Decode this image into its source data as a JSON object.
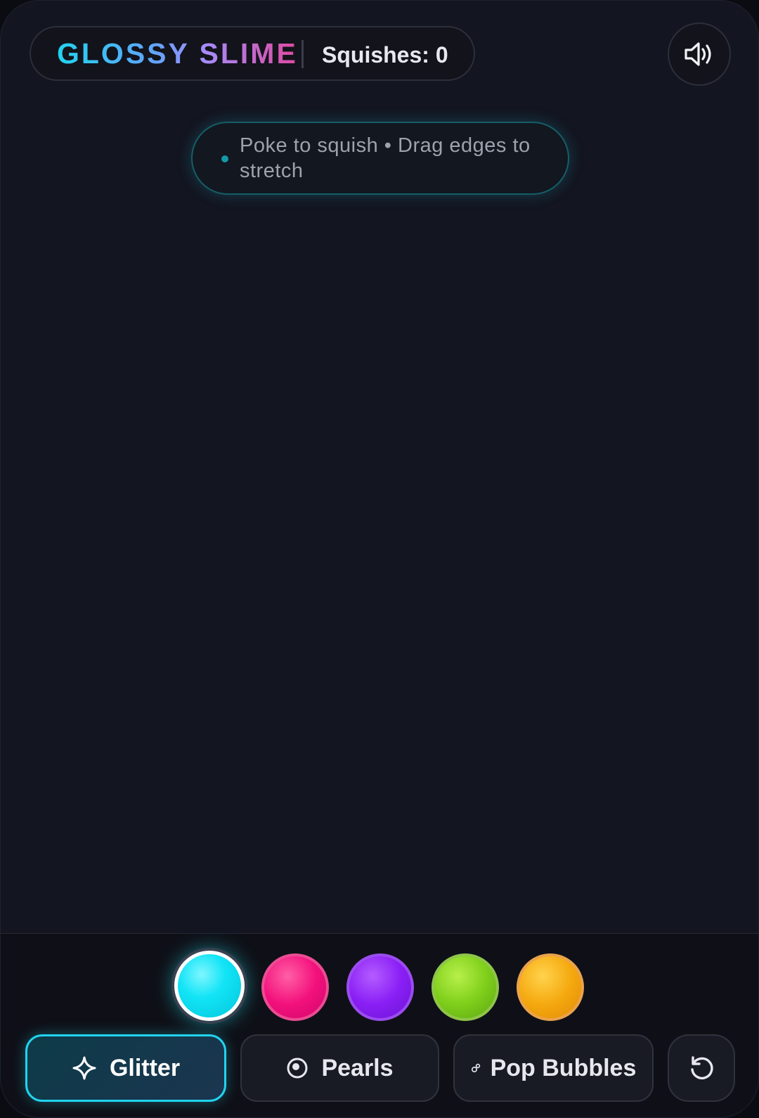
{
  "header": {
    "title": "GLOSSY SLIME",
    "squish_counter": "Squishes: 0"
  },
  "hint": {
    "text": "Poke to squish • Drag edges to stretch"
  },
  "icons": {
    "sound": "speaker-volume-icon",
    "glitter": "sparkle-icon",
    "pearls": "pearl-target-icon",
    "bubbles": "bubble-icon",
    "reset": "rotate-reset-icon"
  },
  "palette": {
    "selected": "cyan",
    "colors": [
      "#12e4f6",
      "#f3117c",
      "#8a1ff5",
      "#7fcf1b",
      "#f5a90f"
    ]
  },
  "modes": {
    "glitter_label": "Glitter",
    "pearls_label": "Pearls",
    "bubbles_label": "Pop Bubbles",
    "active": "Glitter"
  },
  "colors": {
    "accent": "#22d3ee",
    "background": "#131520"
  }
}
